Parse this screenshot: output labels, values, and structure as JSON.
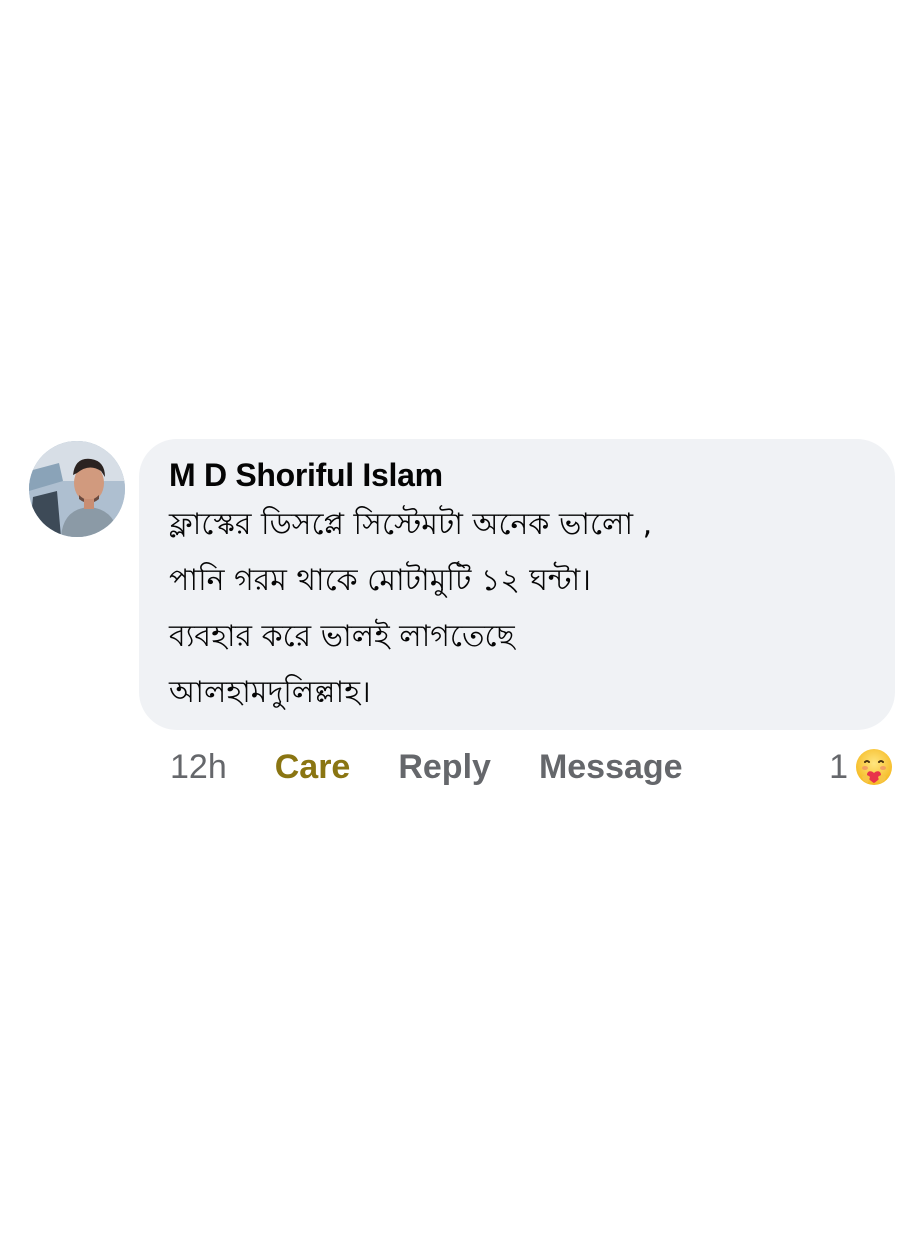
{
  "comment": {
    "author": "M D Shoriful Islam",
    "lines": [
      "ফ্লাস্কের ডিসপ্লে সিস্টেমটা  অনেক ভালো ,",
      "পানি গরম থাকে মোটামুটি ১২ ঘন্টা।",
      "ব্যবহার করে ভালই লাগতেছে",
      "আলহামদুলিল্লাহ।"
    ]
  },
  "actions": {
    "time": "12h",
    "reaction_label": "Care",
    "reply_label": "Reply",
    "message_label": "Message"
  },
  "reactions": {
    "count": "1",
    "icon": "care-emoji-icon"
  },
  "colors": {
    "bubble_bg": "#f0f2f5",
    "care_accent": "#8a7512",
    "meta_text": "#65676b"
  }
}
